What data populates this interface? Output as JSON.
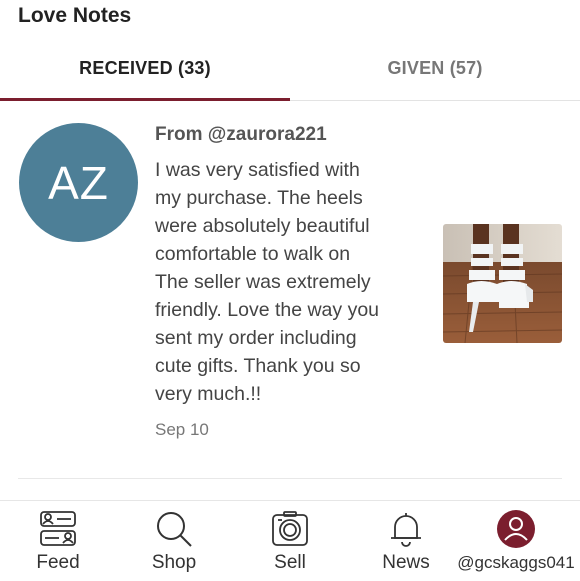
{
  "page": {
    "title": "Love Notes"
  },
  "tabs": [
    {
      "label": "RECEIVED (33)",
      "active": true
    },
    {
      "label": "GIVEN (57)",
      "active": false
    }
  ],
  "note": {
    "avatar_initials": "AZ",
    "avatar_color": "#4d7f97",
    "from": "From @zaurora221",
    "message": "I was very satisfied with\nmy purchase. The heels\nwere absolutely beautiful\ncomfortable to walk on\nThe seller was extremely\nfriendly. Love the way you\nsent my order including\ncute gifts. Thank you so\nvery much.!!",
    "date": "Sep 10",
    "photo_icon": "white-platform-heels-photo"
  },
  "bottom_nav": {
    "items": [
      {
        "label": "Feed",
        "icon": "feed-icon"
      },
      {
        "label": "Shop",
        "icon": "search-icon"
      },
      {
        "label": "Sell",
        "icon": "camera-icon"
      },
      {
        "label": "News",
        "icon": "bell-icon"
      },
      {
        "label": "@gcskaggs041",
        "icon": "user-avatar-icon"
      }
    ]
  },
  "colors": {
    "accent": "#7b1e2e",
    "active_tab_text": "#222222",
    "inactive_tab_text": "#777777"
  }
}
